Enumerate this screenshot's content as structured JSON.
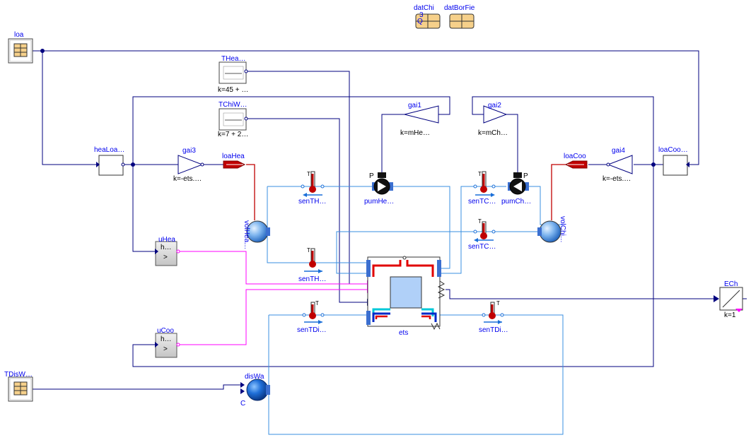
{
  "labels": {
    "loa": "loa",
    "datChi": "datChi",
    "datBorFie": "datBorFie",
    "THea": "THea…",
    "THea_k": "k=45 + …",
    "TChiW": "TChiW…",
    "TChiW_k": "k=7 + 2…",
    "gai1": "gai1",
    "gai1_k": "k=mHe…",
    "gai2": "gai2",
    "gai2_k": "k=mCh…",
    "heaLoa": "heaLoa…",
    "gai3": "gai3",
    "gai3_k": "k=-ets.…",
    "loaHea": "loaHea",
    "loaCoo": "loaCoo",
    "gai4": "gai4",
    "gai4_k": "k=-ets.…",
    "loaCoo2": "loaCoo…",
    "senTH1": "senTH…",
    "pumHe": "pumHe…",
    "senTC1": "senTC…",
    "pumCh": "pumCh…",
    "volHea": "volHea…",
    "volChi": "volChi…",
    "senTC2": "senTC…",
    "uHea": "uHea",
    "uHea_inner": "h…",
    "senTH2": "senTH…",
    "senTDi1": "senTDi…",
    "senTDi2": "senTDi…",
    "ets": "ets",
    "ECh": "ECh",
    "ECh_k": "k=1",
    "uCoo": "uCoo",
    "uCoo_inner": "h…",
    "TDisW": "TDisW…",
    "disWa": "disWa",
    "T": "T",
    "P": "P",
    "Q": "Q",
    "three": "3",
    "gt": ">",
    "C": "C"
  },
  "colors": {
    "bus": "#00007f",
    "fluid": "#3a8fe0",
    "signal": "#ff00ff",
    "flow": "#c00000",
    "label": "#0000ee"
  }
}
